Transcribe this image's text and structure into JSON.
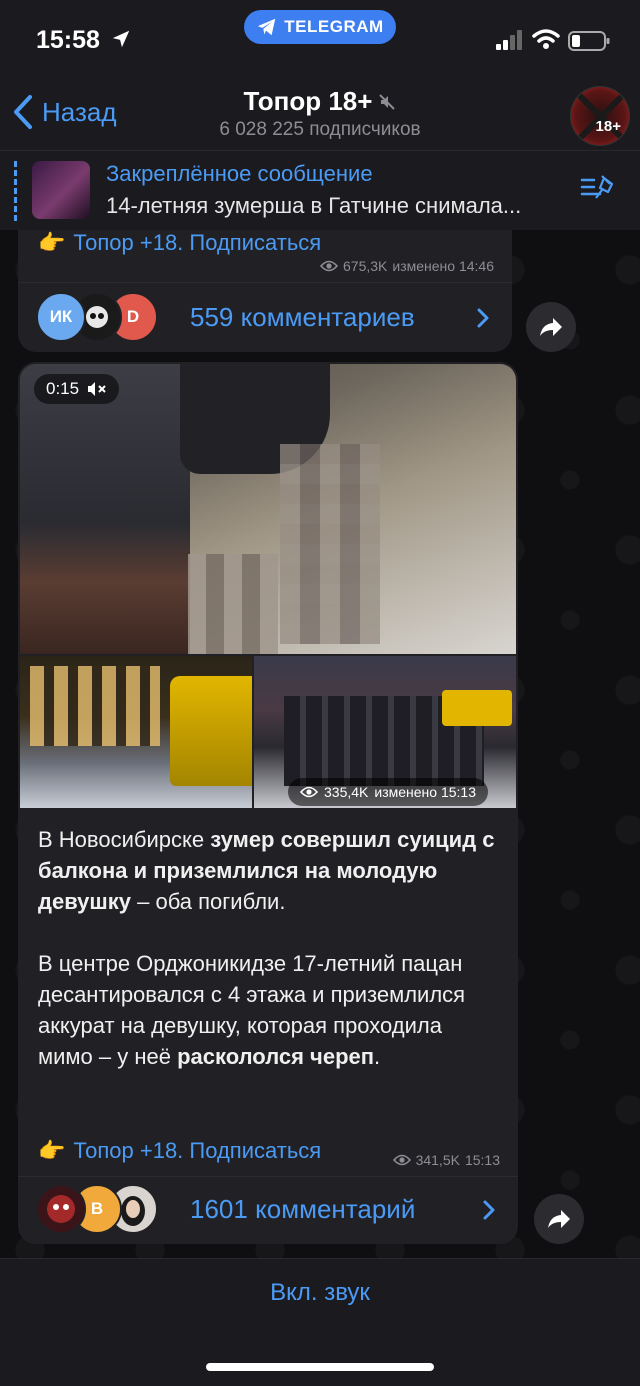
{
  "status_bar": {
    "time": "15:58",
    "pill_label": "TELEGRAM"
  },
  "header": {
    "back_label": "Назад",
    "title": "Топор 18+",
    "subscribers": "6 028 225 подписчиков",
    "avatar_text": "18+"
  },
  "pinned": {
    "title": "Закреплённое сообщение",
    "text": "14-летняя зумерша в Гатчине снимала..."
  },
  "message1": {
    "link": "Топор +18. Подписаться",
    "views": "675,3K",
    "edited": "изменено 14:46",
    "avatars": [
      "ИК",
      "",
      "D"
    ],
    "comments": "559 комментариев"
  },
  "message2": {
    "video_duration": "0:15",
    "photo_views": "335,4K",
    "photo_edited": "изменено 15:13",
    "p1_a": "В Новосибирске ",
    "p1_b": "зумер совершил суицид с балкона и приземлился на молодую девушку",
    "p1_c": " – оба погибли.",
    "p2_a": "В центре Орджоникидзе 17-летний пацан десантировался с 4 этажа и приземлился аккурат на девушку, которая проходила мимо – у неё ",
    "p2_b": "раскололся череп",
    "p2_c": ".",
    "link": "Топор +18. Подписаться",
    "views": "341,5K",
    "time": "15:13",
    "avatars": [
      "",
      "B",
      ""
    ],
    "comments": "1601 комментарий"
  },
  "bottom": {
    "sound_button": "Вкл. звук"
  },
  "colors": {
    "accent": "#4b9bf5",
    "bubble": "#212125",
    "bar": "#1b1b1f"
  },
  "icons": [
    "location-arrow-icon",
    "telegram-icon",
    "signal-icon",
    "wifi-icon",
    "battery-icon",
    "back-chevron-icon",
    "mute-icon",
    "pin-list-icon",
    "eye-icon",
    "chevron-right-icon",
    "share-icon",
    "muted-speaker-icon",
    "pointing-hand-icon"
  ]
}
